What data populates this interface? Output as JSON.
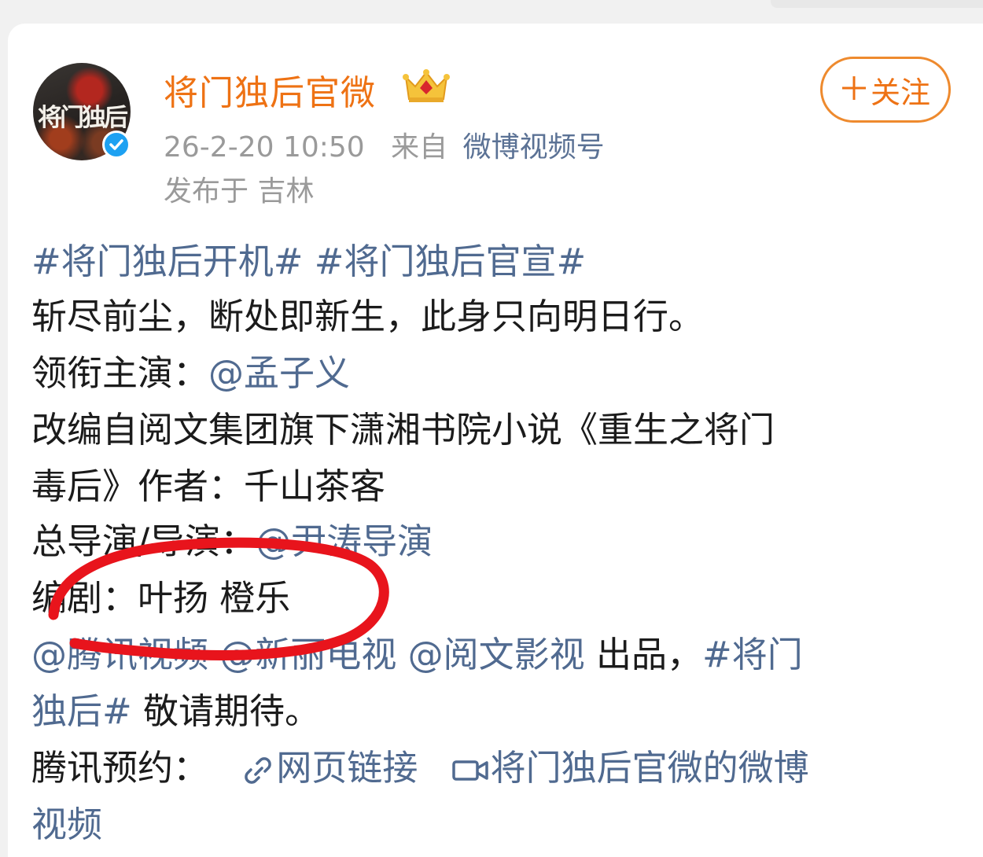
{
  "post": {
    "author": {
      "name": "将门独后官微",
      "avatar_text": "将门独后",
      "badge_icon": "crown-badge-icon",
      "verified_icon": "verified-icon"
    },
    "follow_label": "关注",
    "timestamp": "26-2-20 10:50",
    "source_prefix": "来自",
    "source": "微博视频号",
    "location": "发布于 吉林",
    "content": {
      "l1_tag1": "#将门独后开机#",
      "l1_tag2": "#将门独后官宣#",
      "l2": "斩尽前尘，断处即新生，此身只向明日行。",
      "l3_label": "领衔主演：",
      "l3_mention": "@孟子义",
      "l4": "改编自阅文集团旗下潇湘书院小说《重生之将门",
      "l5": "毒后》作者：千山茶客",
      "l6_label": "总导演/导演：",
      "l6_mention": "@尹涛导演",
      "l7": "编剧：叶扬 橙乐",
      "l8_m1": "@腾讯视频",
      "l8_m2": "@新丽电视",
      "l8_m3": "@阅文影视",
      "l8_text": "出品，",
      "l8_tag": "#将门",
      "l9_tag": "独后#",
      "l9_text": "敬请期待。",
      "l10_label": "腾讯预约：",
      "l10_link1": "网页链接",
      "l10_link2": "将门独后官微的微博",
      "l11_link2": "视频"
    }
  },
  "colors": {
    "username": "#ee7214",
    "link": "#506a90",
    "meta": "#9a9a9a",
    "annotation": "#e8141c"
  }
}
